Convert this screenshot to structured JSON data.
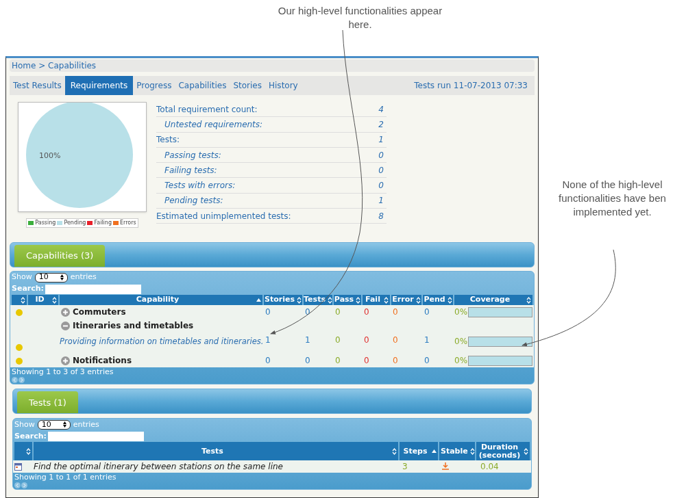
{
  "annotations": [
    {
      "text": "Our high-level functionalities appear here."
    },
    {
      "text": "None of the high-level functionalities have ben implemented yet."
    }
  ],
  "breadcrumb": "Home > Capabilities",
  "tabs": [
    {
      "label": "Test Results",
      "selected": false
    },
    {
      "label": "Requirements",
      "selected": true
    },
    {
      "label": "Progress",
      "selected": false
    },
    {
      "label": "Capabilities",
      "selected": false
    },
    {
      "label": "Stories",
      "selected": false
    },
    {
      "label": "History",
      "selected": false
    }
  ],
  "tests_run": "Tests run 11-07-2013 07:33",
  "pie": {
    "chart_data": {
      "type": "pie",
      "categories": [
        "Passing",
        "Pending",
        "Failing",
        "Errors"
      ],
      "values": [
        0,
        100,
        0,
        0
      ]
    },
    "slice_label": "100%",
    "legend": [
      {
        "color": "#3cae3c"
      },
      {
        "color": "#b8e0e8"
      },
      {
        "color": "#e8202a"
      },
      {
        "color": "#f07020"
      }
    ]
  },
  "stats": [
    {
      "kind": "main",
      "label": "Total requirement count:",
      "value": "4"
    },
    {
      "kind": "sub",
      "label": "Untested requirements:",
      "value": "2"
    },
    {
      "kind": "main",
      "label": "Tests:",
      "value": "1"
    },
    {
      "kind": "sub",
      "label": "Passing tests:",
      "value": "0"
    },
    {
      "kind": "sub",
      "label": "Failing tests:",
      "value": "0"
    },
    {
      "kind": "sub",
      "label": "Tests with errors:",
      "value": "0"
    },
    {
      "kind": "sub",
      "label": "Pending tests:",
      "value": "1"
    },
    {
      "kind": "main",
      "label": "Estimated unimplemented tests:",
      "value": "8"
    }
  ],
  "capabilities": {
    "title": "Capabilities (3)",
    "show": "Show",
    "page_size": "10",
    "entries": "entries",
    "search_label": "Search:",
    "columns": [
      {
        "sorted": false
      },
      {
        "label": "ID",
        "sorted": false
      },
      {
        "label": "Capability",
        "sorted": true
      },
      {
        "label": "Stories",
        "sorted": false
      },
      {
        "label": "Tests",
        "sorted": false
      },
      {
        "label": "Pass",
        "sorted": false
      },
      {
        "label": "Fail",
        "sorted": false
      },
      {
        "label": "Error",
        "sorted": false
      },
      {
        "label": "Pend",
        "sorted": false
      },
      {
        "label": "Coverage",
        "sorted": false
      }
    ],
    "rows": [
      {
        "color": "#e8c800",
        "name": "Commuters",
        "expanded": false,
        "stories": "0",
        "tests": "0",
        "pass": "0",
        "fail": "0",
        "error": "0",
        "pend": "0",
        "coverage": "0%",
        "level": 0
      },
      {
        "color": "#e8c800",
        "name": "Itineraries and timetables",
        "expanded": true,
        "description": "Providing information on timetables and itineraries.",
        "stories": "1",
        "tests": "1",
        "pass": "0",
        "fail": "0",
        "error": "0",
        "pend": "1",
        "coverage": "0%",
        "level": 0
      },
      {
        "color": "#e8c800",
        "name": "Notifications",
        "expanded": false,
        "stories": "0",
        "tests": "0",
        "pass": "0",
        "fail": "0",
        "error": "0",
        "pend": "0",
        "coverage": "0%",
        "level": 0
      }
    ],
    "info": "Showing 1 to 3 of 3 entries"
  },
  "tests": {
    "title": "Tests (1)",
    "show": "Show",
    "page_size": "10",
    "entries": "entries",
    "search_label": "Search:",
    "columns": [
      {
        "sorted": false
      },
      {
        "label": "Tests",
        "sorted": false
      },
      {
        "label": "Steps",
        "sorted": true
      },
      {
        "label": "Stable",
        "sorted": false
      },
      {
        "label": "Duration (seconds)",
        "sorted": false
      }
    ],
    "rows": [
      {
        "name": "Find the optimal itinerary between stations on the same line",
        "steps": "3",
        "duration": "0.04"
      }
    ],
    "info": "Showing 1 to 1 of 1 entries"
  }
}
